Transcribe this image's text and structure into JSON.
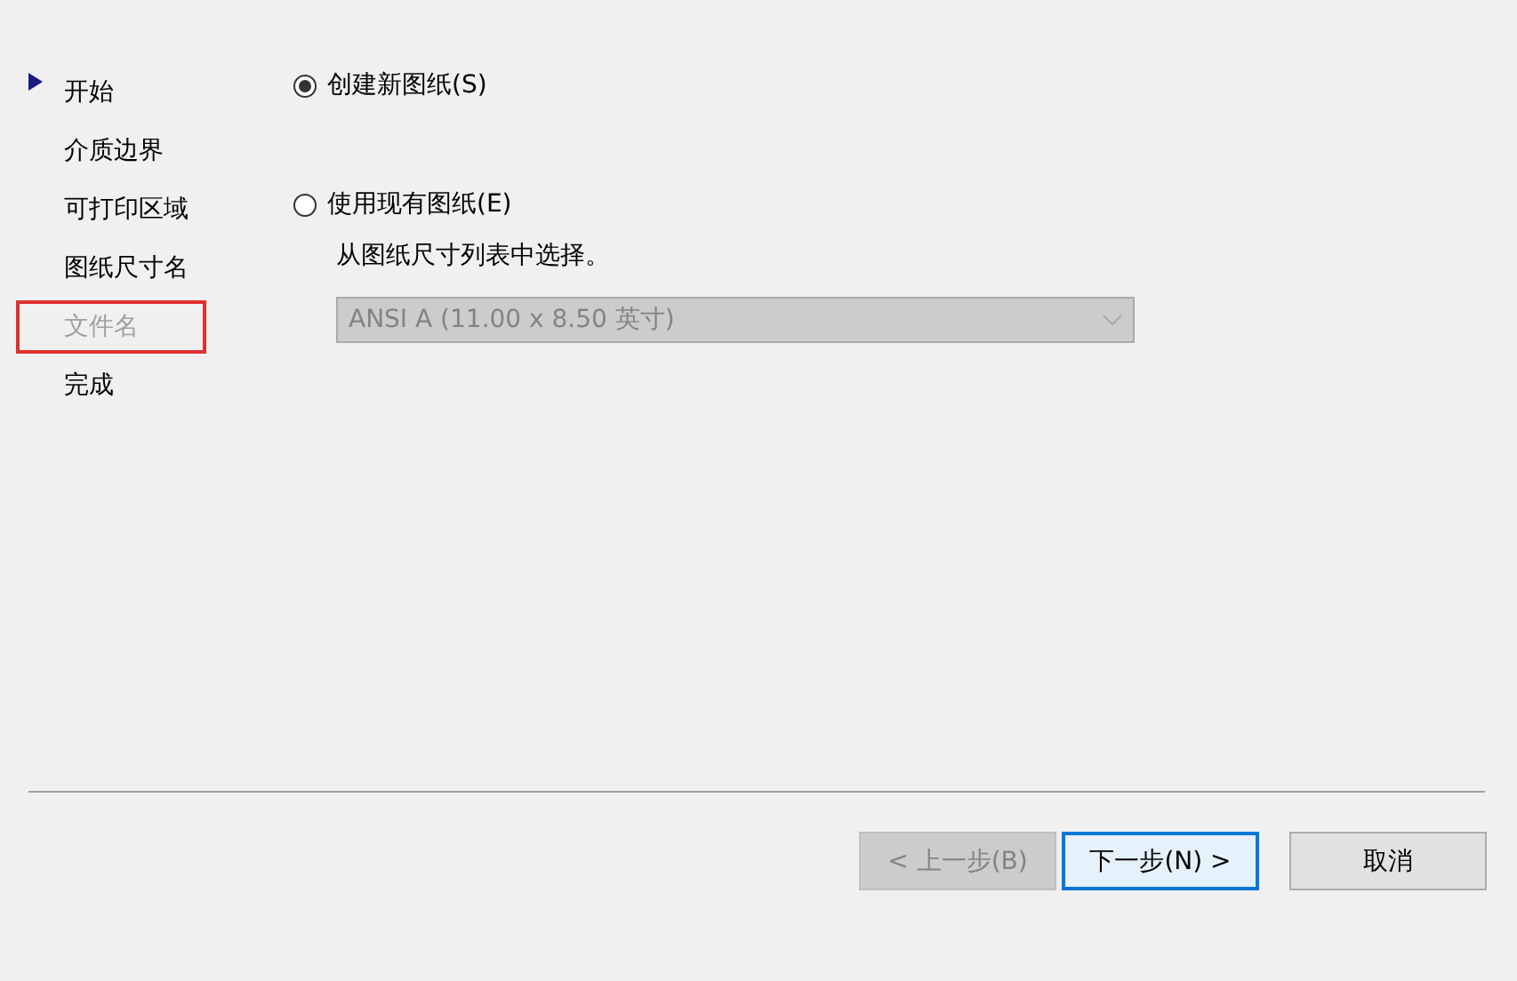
{
  "steps": [
    {
      "label": "开始",
      "current": true,
      "disabled": false,
      "highlighted": false
    },
    {
      "label": "介质边界",
      "current": false,
      "disabled": false,
      "highlighted": false
    },
    {
      "label": "可打印区域",
      "current": false,
      "disabled": false,
      "highlighted": false
    },
    {
      "label": "图纸尺寸名",
      "current": false,
      "disabled": false,
      "highlighted": false
    },
    {
      "label": "文件名",
      "current": false,
      "disabled": true,
      "highlighted": true
    },
    {
      "label": "完成",
      "current": false,
      "disabled": false,
      "highlighted": false
    }
  ],
  "options": [
    {
      "label": "创建新图纸(S)",
      "selected": true
    },
    {
      "label": "使用现有图纸(E)",
      "selected": false
    }
  ],
  "hint": "从图纸尺寸列表中选择。",
  "paper_select": {
    "value": "ANSI A (11.00 x 8.50 英寸)",
    "disabled": true
  },
  "buttons": [
    {
      "label": "< 上一步(B)",
      "disabled": true,
      "focused": false
    },
    {
      "label": "下一步(N) >",
      "disabled": false,
      "focused": true
    },
    {
      "label": "取消",
      "disabled": false,
      "focused": false
    }
  ]
}
